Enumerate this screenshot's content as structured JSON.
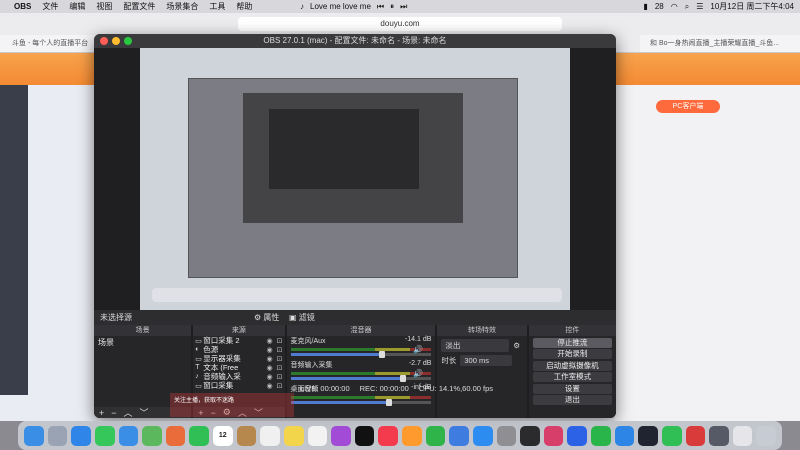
{
  "menubar": {
    "app_name": "OBS",
    "items": [
      "文件",
      "编辑",
      "视图",
      "配置文件",
      "场景集合",
      "工具",
      "帮助"
    ],
    "now_playing": "Love me love me",
    "battery": "28",
    "datetime": "10月12日 周二下午4:04"
  },
  "browser": {
    "address": "douyu.com",
    "tab_left": "斗鱼 - 每个人的直播平台",
    "tab_right": "和 Bo一身热闹直播_主播荣耀直播_斗鱼..."
  },
  "douyu": {
    "pc_client_label": "PC客户端"
  },
  "obs": {
    "title": "OBS 27.0.1 (mac) - 配置文件: 未命名 - 场景: 未命名",
    "no_source_selected": "未选择源",
    "properties_label": "属性",
    "filters_label": "滤镜",
    "panels": {
      "scenes": {
        "header": "场景",
        "items": [
          "场景"
        ]
      },
      "sources": {
        "header": "来源",
        "items": [
          {
            "icon": "▭",
            "name": "窗口采集 2"
          },
          {
            "icon": "◐",
            "name": "色源"
          },
          {
            "icon": "▭",
            "name": "显示器采集"
          },
          {
            "icon": "T",
            "name": "文本 (Free"
          },
          {
            "icon": "♪",
            "name": "音频输入采"
          },
          {
            "icon": "▭",
            "name": "窗口采集"
          }
        ]
      },
      "mixer": {
        "header": "混音器",
        "channels": [
          {
            "name": "麦克风/Aux",
            "db": "-14.1 dB",
            "level": 0.65
          },
          {
            "name": "音频输入采集",
            "db": "-2.7 dB",
            "level": 0.8
          },
          {
            "name": "桌面音频",
            "db": "-inf dB",
            "level": 0.7
          }
        ]
      },
      "transitions": {
        "header": "转场特效",
        "type": "淡出",
        "duration_label": "时长",
        "duration_value": "300 ms"
      },
      "controls": {
        "header": "控件",
        "buttons": [
          "停止推流",
          "开始录制",
          "启动虚拟摄像机",
          "工作室模式",
          "设置",
          "退出"
        ]
      }
    },
    "status": {
      "live": "LIVE: 00:00:00",
      "rec": "REC: 00:00:00",
      "cpu": "CPU: 14.1%,60.00 fps"
    }
  },
  "overlay_text": "关注主播，获取不迷路",
  "dock": {
    "calendar_day": "12",
    "apps": [
      {
        "name": "finder",
        "color": "#3a8ee6"
      },
      {
        "name": "launchpad",
        "color": "#9aa3b3"
      },
      {
        "name": "safari",
        "color": "#2f86e8"
      },
      {
        "name": "messages",
        "color": "#35c759"
      },
      {
        "name": "mail",
        "color": "#3a8ee6"
      },
      {
        "name": "maps",
        "color": "#5bb85d"
      },
      {
        "name": "photos",
        "color": "#e96c3a"
      },
      {
        "name": "facetime",
        "color": "#2fbf55"
      },
      {
        "name": "calendar",
        "color": "#ffffff"
      },
      {
        "name": "notes-brown",
        "color": "#b7884e"
      },
      {
        "name": "reminders",
        "color": "#f0f0f0"
      },
      {
        "name": "notes",
        "color": "#f3d54c"
      },
      {
        "name": "freeform",
        "color": "#f2f2f2"
      },
      {
        "name": "podcasts",
        "color": "#a24bd6"
      },
      {
        "name": "appletv",
        "color": "#111111"
      },
      {
        "name": "music",
        "color": "#f33b4d"
      },
      {
        "name": "pages",
        "color": "#ff9a2e"
      },
      {
        "name": "numbers",
        "color": "#2fb44a"
      },
      {
        "name": "keynote",
        "color": "#3f7ce0"
      },
      {
        "name": "appstore",
        "color": "#2d8cf0"
      },
      {
        "name": "settings",
        "color": "#8e8e93"
      },
      {
        "name": "obs",
        "color": "#2b2b2d"
      },
      {
        "name": "toolbox",
        "color": "#d73f6a"
      },
      {
        "name": "baidu",
        "color": "#2b62e6"
      },
      {
        "name": "iqiyi",
        "color": "#2ab54a"
      },
      {
        "name": "tencent",
        "color": "#2d86e6"
      },
      {
        "name": "app-dark",
        "color": "#1f2430"
      },
      {
        "name": "wechat",
        "color": "#2fbf55"
      },
      {
        "name": "netease",
        "color": "#d93b3b"
      },
      {
        "name": "screenshot",
        "color": "#555a66"
      },
      {
        "name": "screen-mirror",
        "color": "#e5e5ea"
      },
      {
        "name": "trash",
        "color": "#c7cbd3"
      }
    ]
  }
}
